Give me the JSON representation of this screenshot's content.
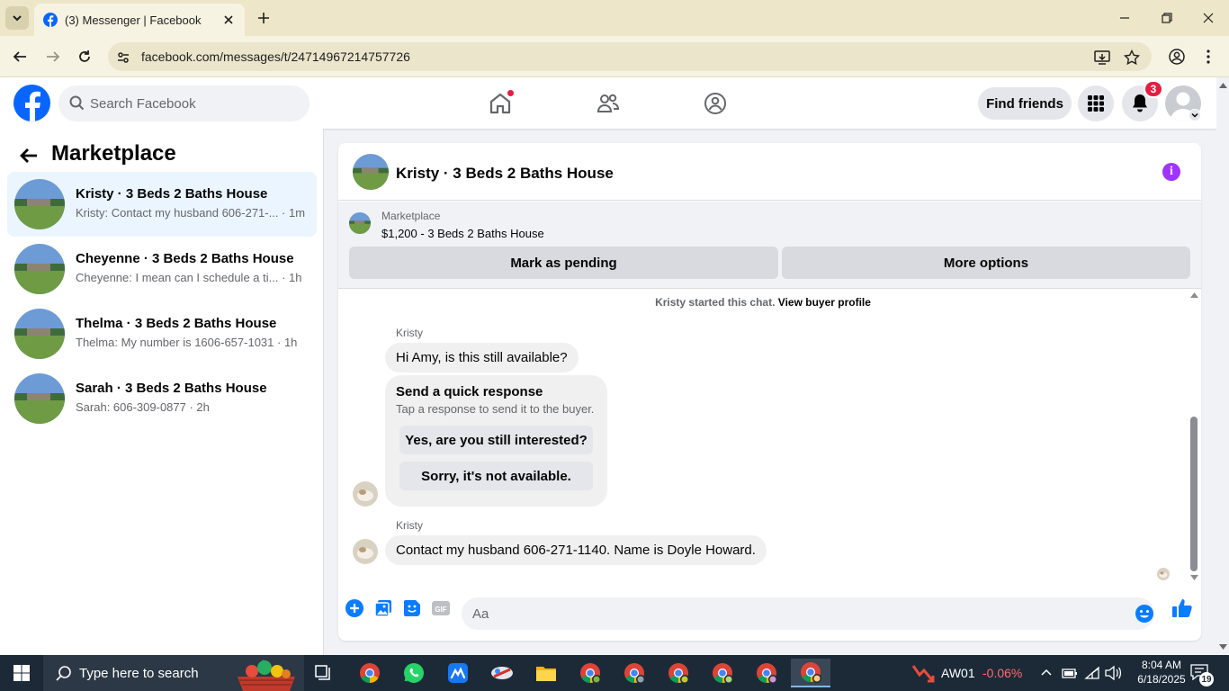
{
  "browser": {
    "tab_title": "(3) Messenger | Facebook",
    "url": "facebook.com/messages/t/24714967214757726"
  },
  "fb_header": {
    "search_placeholder": "Search Facebook",
    "find_friends": "Find friends",
    "notification_count": "3"
  },
  "left_panel": {
    "title": "Marketplace",
    "conversations": [
      {
        "name": "Kristy · 3 Beds 2 Baths House",
        "snippet": "Kristy: Contact my husband 606-271-... · 1m",
        "active": true
      },
      {
        "name": "Cheyenne · 3 Beds 2 Baths House",
        "snippet": "Cheyenne: I mean can I schedule a ti...   · 1h",
        "active": false
      },
      {
        "name": "Thelma · 3 Beds 2 Baths House",
        "snippet": "Thelma: My number is 1606-657-1031 · 1h",
        "active": false
      },
      {
        "name": "Sarah · 3 Beds 2 Baths House",
        "snippet": "Sarah: 606-309-0877 · 2h",
        "active": false
      }
    ]
  },
  "chat": {
    "title": "Kristy · 3 Beds 2 Baths House",
    "listing": {
      "category": "Marketplace",
      "price_title": "$1,200 - 3 Beds 2 Baths House"
    },
    "buttons": {
      "mark_pending": "Mark as pending",
      "more_options": "More options"
    },
    "started_text": "Kristy started this chat.",
    "view_profile": "View buyer profile",
    "messages": [
      {
        "sender": "Kristy",
        "text": "Hi Amy, is this still available?"
      },
      {
        "sender": "Kristy",
        "text": "Contact my husband 606-271-1140. Name is Doyle Howard."
      }
    ],
    "quick_response": {
      "title": "Send a quick response",
      "subtitle": "Tap a response to send it to the buyer.",
      "options": [
        "Yes, are you still interested?",
        "Sorry, it's not available."
      ]
    },
    "composer_placeholder": "Aa"
  },
  "taskbar": {
    "search_placeholder": "Type here to search",
    "stock_name": "AW01",
    "stock_change": "-0.06%",
    "time": "8:04 AM",
    "date": "6/18/2025",
    "notification_count": "19"
  },
  "colors": {
    "fb_blue": "#0866ff",
    "messenger_blue": "#0a7cff",
    "notification_red": "#e41e3f",
    "info_purple": "#a033ff",
    "active_conversation": "#ebf5ff"
  }
}
